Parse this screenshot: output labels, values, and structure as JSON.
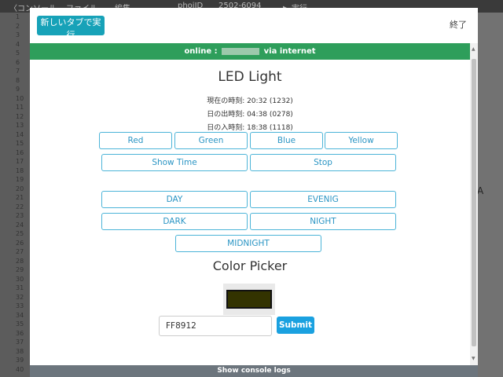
{
  "background": {
    "toolbar_items": [
      "〈コンソール",
      "ファイル",
      "編集",
      "phoiID",
      "2502-6094",
      "▶ 実行"
    ],
    "line_numbers": [
      "1",
      "2",
      "3",
      "4",
      "5",
      "6",
      "7",
      "8",
      "9",
      "10",
      "11",
      "12",
      "13",
      "14",
      "15",
      "16",
      "17",
      "18",
      "19",
      "20",
      "21",
      "22",
      "23",
      "24",
      "25",
      "26",
      "27",
      "28",
      "29",
      "30",
      "31",
      "32",
      "33",
      "34",
      "35",
      "36",
      "37",
      "38",
      "39",
      "40"
    ],
    "right_char": "A"
  },
  "modal": {
    "new_tab_label": "新しいタブで実行",
    "close_label": "終了",
    "console_label": "Show console logs"
  },
  "status": {
    "prefix": "online :",
    "suffix": "via internet",
    "color": "#2e9e5b"
  },
  "led": {
    "title": "LED Light",
    "current_time": "現在の時刻: 20:32 (1232)",
    "sunrise": "日の出時刻: 04:38 (0278)",
    "sunset": "日の入時刻: 18:38 (1118)",
    "color_buttons": [
      "Red",
      "Green",
      "Blue",
      "Yellow"
    ],
    "show_time_label": "Show Time",
    "stop_label": "Stop",
    "mode_buttons": [
      "DAY",
      "EVENIG",
      "DARK",
      "NIGHT"
    ],
    "midnight_label": "MIDNIGHT"
  },
  "picker": {
    "title": "Color Picker",
    "swatch_color": "#333300",
    "input_value": "FF8912",
    "submit_label": "Submit"
  },
  "colors": {
    "accent": "#17a2b8",
    "button_text": "#2b95c4",
    "submit": "#1aa1e0"
  }
}
